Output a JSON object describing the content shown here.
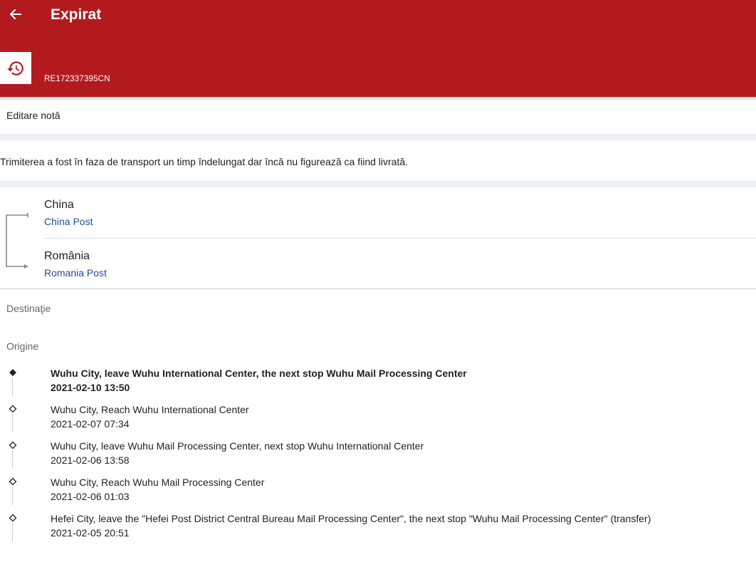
{
  "header": {
    "title": "Expirat",
    "tracking_number": "RE172337395CN",
    "background_color": "#b31a1e",
    "back_icon": "arrow-left-icon",
    "history_icon": "history-icon"
  },
  "note": {
    "edit_label": "Editare notă"
  },
  "status": {
    "message": "Trimiterea a fost în faza de transport un timp îndelungat dar încă nu figurează ca fiind livrată."
  },
  "route": {
    "origin": {
      "country": "China",
      "carrier": "China Post"
    },
    "destination": {
      "country": "România",
      "carrier": "Romania Post"
    },
    "carrier_link_color": "#1f4f9a"
  },
  "sections": {
    "destination_label": "Destinaţie",
    "origin_label": "Origine"
  },
  "events": [
    {
      "description": "Wuhu City, leave Wuhu International Center, the next stop Wuhu Mail Processing Center",
      "time": "2021-02-10 13:50",
      "latest": true
    },
    {
      "description": "Wuhu City, Reach Wuhu International Center",
      "time": "2021-02-07 07:34",
      "latest": false
    },
    {
      "description": "Wuhu City, leave Wuhu Mail Processing Center, next stop Wuhu International Center",
      "time": "2021-02-06 13:58",
      "latest": false
    },
    {
      "description": "Wuhu City, Reach Wuhu Mail Processing Center",
      "time": "2021-02-06 01:03",
      "latest": false
    },
    {
      "description": "Hefei City, leave the \"Hefei Post District Central Bureau Mail Processing Center\", the next stop \"Wuhu Mail Processing Center\" (transfer)",
      "time": "2021-02-05 20:51",
      "latest": false
    }
  ]
}
